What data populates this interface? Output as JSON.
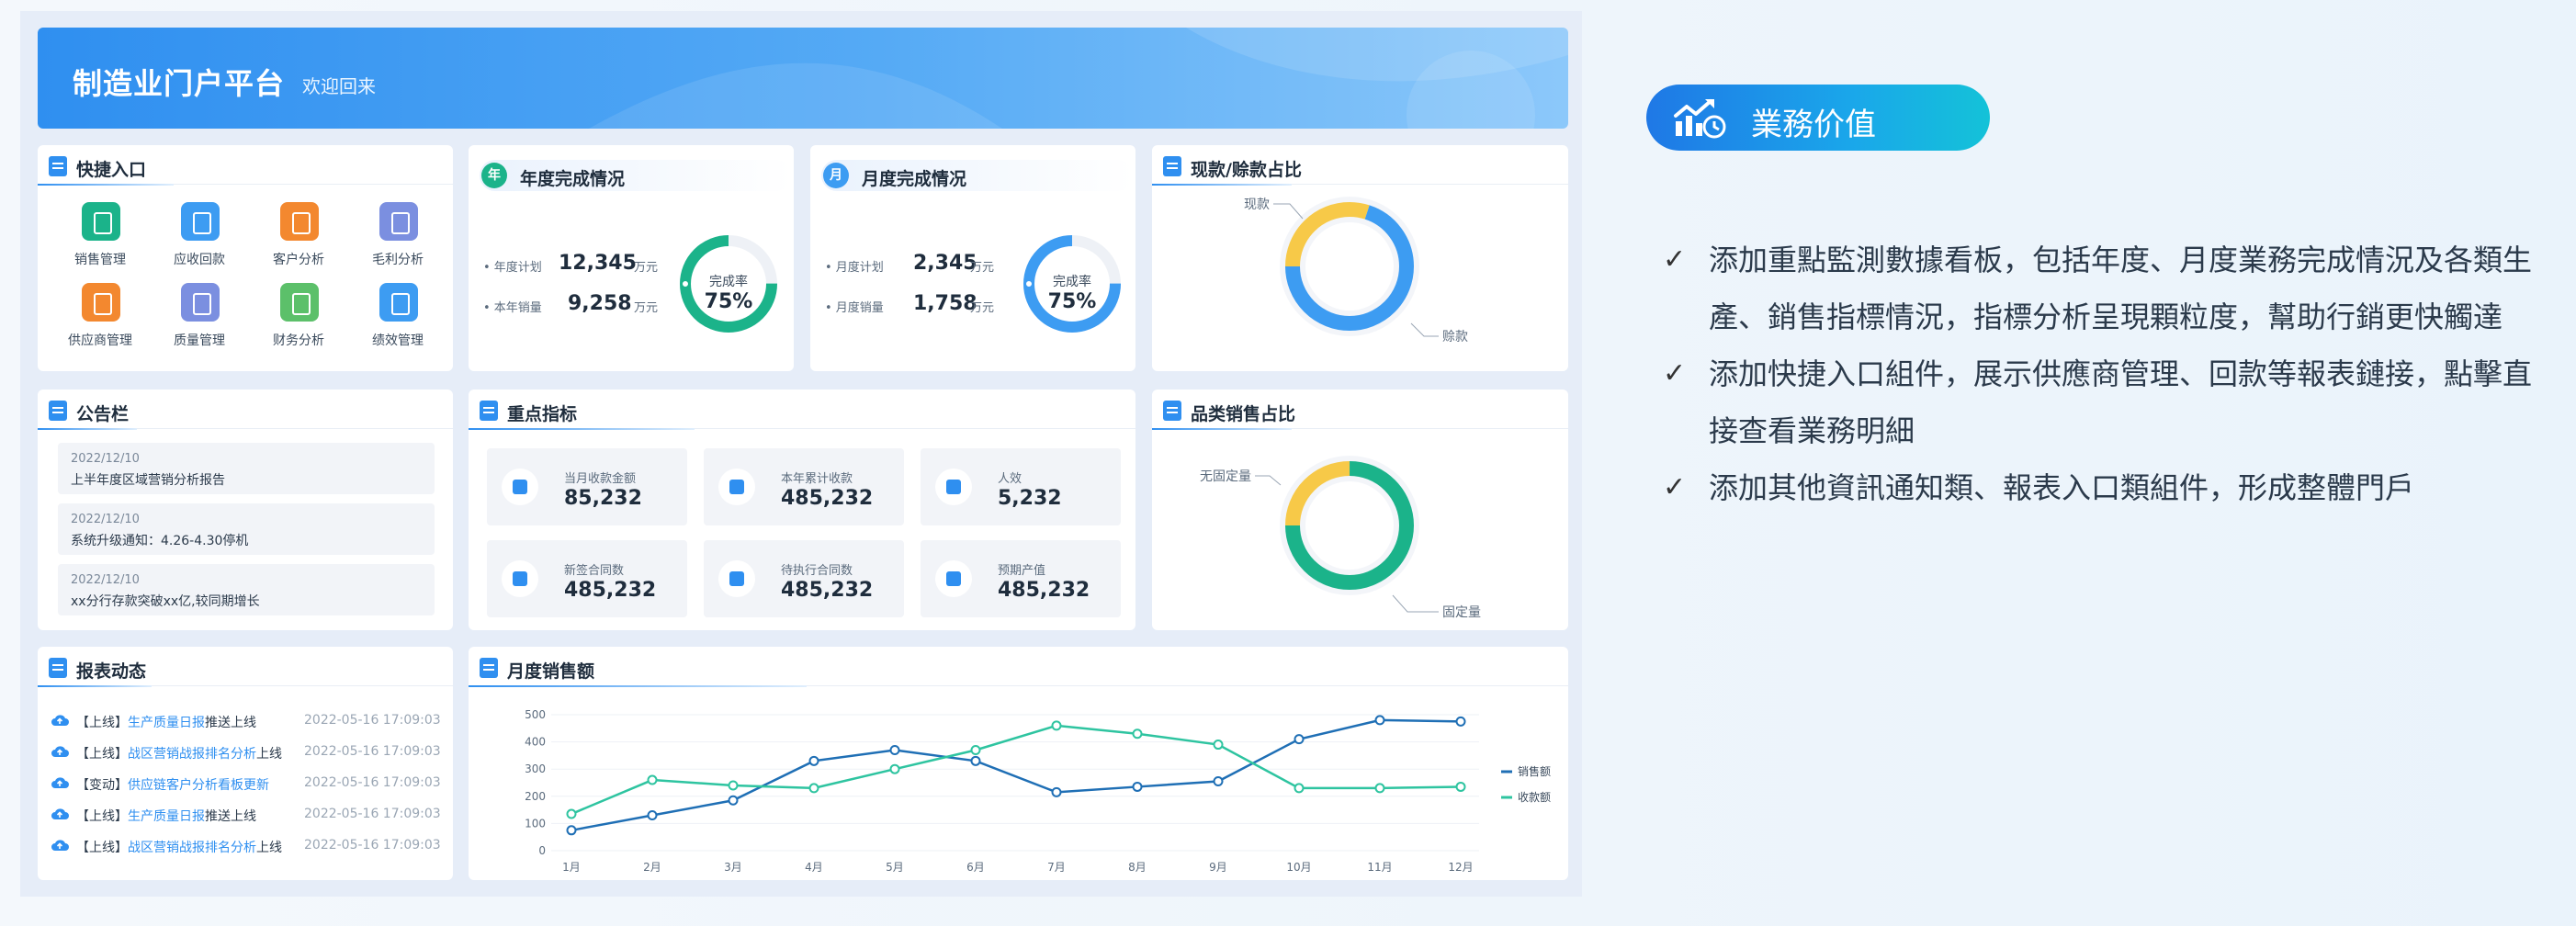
{
  "banner": {
    "title": "制造业门户平台",
    "subtitle": "欢迎回来"
  },
  "quick_entry": {
    "title": "快捷入口",
    "items": [
      {
        "label": "销售管理",
        "color": "#1bb38a"
      },
      {
        "label": "应收回款",
        "color": "#3d9cf2"
      },
      {
        "label": "客户分析",
        "color": "#f3882f"
      },
      {
        "label": "毛利分析",
        "color": "#7b8fe0"
      },
      {
        "label": "供应商管理",
        "color": "#f3882f"
      },
      {
        "label": "质量管理",
        "color": "#7b8fe0"
      },
      {
        "label": "财务分析",
        "color": "#5cc06a"
      },
      {
        "label": "绩效管理",
        "color": "#3d9cf2"
      }
    ]
  },
  "annual": {
    "title": "年度完成情况",
    "badge": "年",
    "badge_color": "#1bb38a",
    "plan_label": "• 年度计划",
    "plan_value": "12,345",
    "plan_unit": "万元",
    "sales_label": "• 本年销量",
    "sales_value": "9,258",
    "sales_unit": "万元",
    "rate_label": "完成率",
    "rate_value": "75%",
    "rate": 0.75,
    "ring_color": "#1bb38a"
  },
  "monthly": {
    "title": "月度完成情况",
    "badge": "月",
    "badge_color": "#3d9cf2",
    "plan_label": "• 月度计划",
    "plan_value": "2,345",
    "plan_unit": "万元",
    "sales_label": "• 月度销量",
    "sales_value": "1,758",
    "sales_unit": "万元",
    "rate_label": "完成率",
    "rate_value": "75%",
    "rate": 0.75,
    "ring_color": "#3d9cf2"
  },
  "cash_credit": {
    "title": "现款/赊款占比",
    "slices": [
      {
        "label": "现款",
        "value": 30,
        "color": "#f7c948"
      },
      {
        "label": "赊款",
        "value": 70,
        "color": "#3d9cf2"
      }
    ]
  },
  "notices": {
    "title": "公告栏",
    "items": [
      {
        "date": "2022/12/10",
        "text": "上半年度区域营销分析报告"
      },
      {
        "date": "2022/12/10",
        "text": "系统升级通知：4.26-4.30停机"
      },
      {
        "date": "2022/12/10",
        "text": "xx分行存款突破xx亿,较同期增长"
      }
    ]
  },
  "kpis": {
    "title": "重点指标",
    "items": [
      {
        "label": "当月收款金额",
        "value": "85,232"
      },
      {
        "label": "本年累计收款",
        "value": "485,232"
      },
      {
        "label": "人效",
        "value": "5,232"
      },
      {
        "label": "新签合同数",
        "value": "485,232"
      },
      {
        "label": "待执行合同数",
        "value": "485,232"
      },
      {
        "label": "预期产值",
        "value": "485,232"
      }
    ]
  },
  "category": {
    "title": "品类销售占比",
    "slices": [
      {
        "label": "无固定量",
        "value": 25,
        "color": "#f7c948"
      },
      {
        "label": "固定量",
        "value": 75,
        "color": "#1bb38a"
      }
    ]
  },
  "reports": {
    "title": "报表动态",
    "items": [
      {
        "tag": "【上线】",
        "link": "生产质量日报",
        "action": "推送上线",
        "time": "2022-05-16 17:09:03"
      },
      {
        "tag": "【上线】",
        "link": "战区营销战报排名分析",
        "action": "上线",
        "time": "2022-05-16 17:09:03"
      },
      {
        "tag": "【变动】",
        "link": "供应链客户分析看板更新",
        "action": "",
        "time": "2022-05-16 17:09:03"
      },
      {
        "tag": "【上线】",
        "link": "生产质量日报",
        "action": "推送上线",
        "time": "2022-05-16 17:09:03"
      },
      {
        "tag": "【上线】",
        "link": "战区营销战报排名分析",
        "action": "上线",
        "time": "2022-05-16 17:09:03"
      }
    ]
  },
  "sales_chart": {
    "title": "月度销售额",
    "yticks": [
      "0",
      "100",
      "200",
      "300",
      "400",
      "500"
    ],
    "xticks": [
      "1月",
      "2月",
      "3月",
      "4月",
      "5月",
      "6月",
      "7月",
      "8月",
      "9月",
      "10月",
      "11月",
      "12月"
    ]
  },
  "chart_data": {
    "type": "line",
    "categories": [
      "1月",
      "2月",
      "3月",
      "4月",
      "5月",
      "6月",
      "7月",
      "8月",
      "9月",
      "10月",
      "11月",
      "12月"
    ],
    "series": [
      {
        "name": "销售额",
        "color": "#1f6fb5",
        "values": [
          75,
          130,
          185,
          330,
          370,
          330,
          215,
          235,
          255,
          410,
          480,
          475
        ]
      },
      {
        "name": "收款额",
        "color": "#2ec4a0",
        "values": [
          135,
          260,
          240,
          230,
          300,
          370,
          460,
          430,
          390,
          230,
          230,
          235
        ]
      }
    ],
    "ylim": [
      0,
      500
    ],
    "grid": true,
    "legend": "right"
  },
  "value_panel": {
    "title": "業務价值",
    "bullets": [
      "添加重點監測數據看板，包括年度、月度業務完成情況及各類生產、銷售指標情況，指標分析呈現顆粒度，幫助行銷更快觸達",
      "添加快捷入口組件，展示供應商管理、回款等報表鏈接，點擊直接查看業務明細",
      "添加其他資訊通知類、報表入口類組件，形成整體門戶"
    ],
    "check": "✓"
  }
}
